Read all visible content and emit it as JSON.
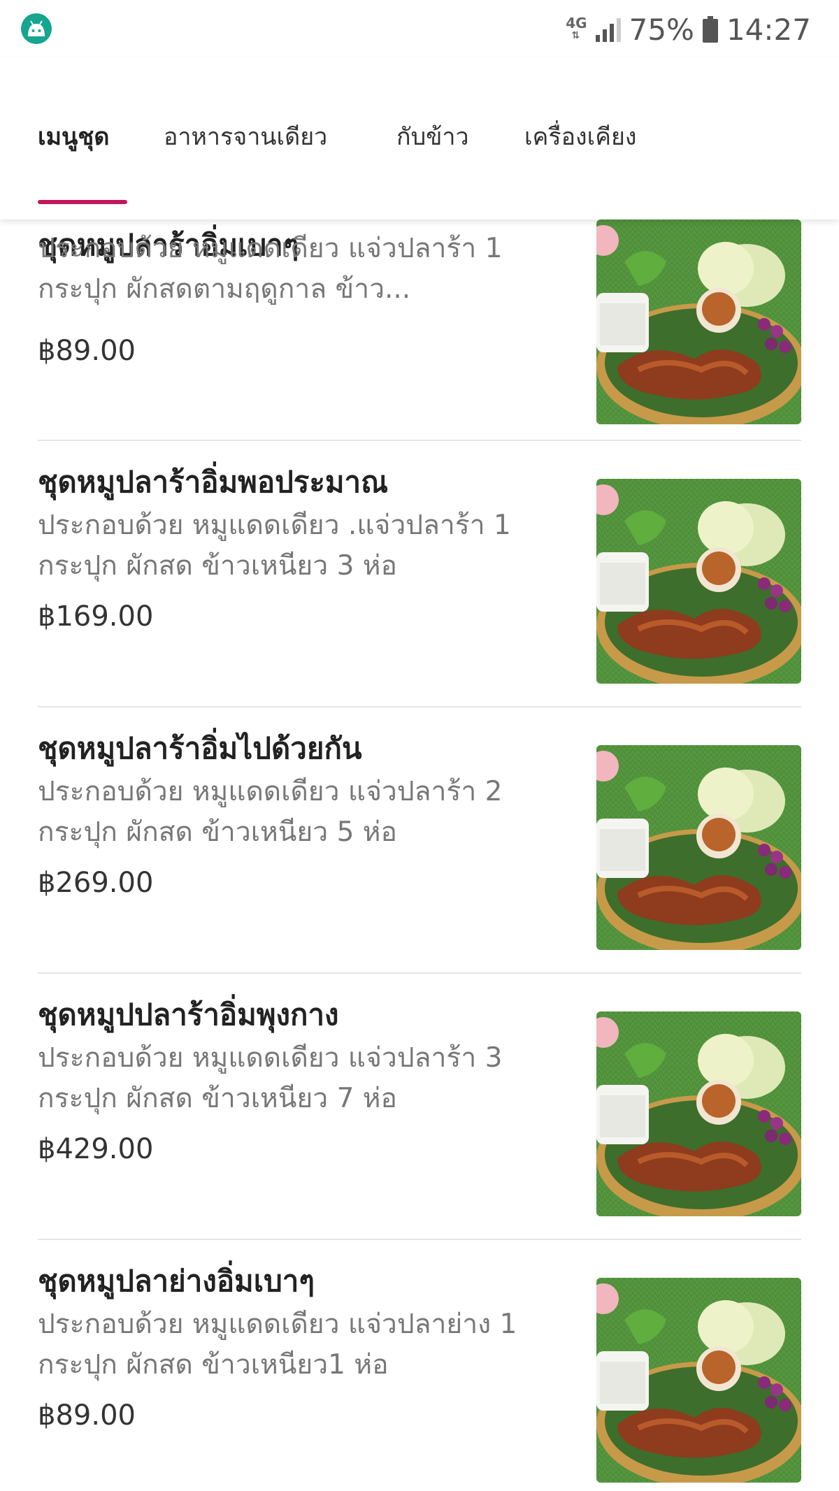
{
  "status_bar": {
    "network": "4G",
    "battery": "75%",
    "time": "14:27",
    "icons": [
      "android-app-icon",
      "network-4g-icon",
      "signal-icon",
      "battery-icon"
    ]
  },
  "tabs": [
    {
      "label": "เมนูชุด",
      "active": true
    },
    {
      "label": "อาหารจานเดียว",
      "active": false
    },
    {
      "label": "กับข้าว",
      "active": false
    },
    {
      "label": "เครื่องเคียง",
      "active": false
    }
  ],
  "accent_color": "#c2185b",
  "items": [
    {
      "title": "ชุดหมูปลาร้าอิ่มเบาๆ",
      "desc": "ประกอบด้วย หมูแดดเดียว แจ่วปลาร้า 1 กระปุก ผักสดตามฤดูกาล ข้าว...",
      "price": "฿89.00",
      "image": "food-photo"
    },
    {
      "title": "ชุดหมูปลาร้าอิ่มพอประมาณ",
      "desc": "ประกอบด้วย หมูแดดเดียว .แจ่วปลาร้า 1 กระปุก ผักสด ข้าวเหนียว 3 ห่อ",
      "price": "฿169.00",
      "image": "food-photo"
    },
    {
      "title": "ชุดหมูปลาร้าอิ่มไปด้วยกัน",
      "desc": "ประกอบด้วย หมูแดดเดียว แจ่วปลาร้า 2 กระปุก ผักสด ข้าวเหนียว 5 ห่อ",
      "price": "฿269.00",
      "image": "food-photo"
    },
    {
      "title": "ชุดหมูปปลาร้าอิ่มพุงกาง",
      "desc": "ประกอบด้วย หมูแดดเดียว แจ่วปลาร้า 3 กระปุก ผักสด ข้าวเหนียว 7 ห่อ",
      "price": "฿429.00",
      "image": "food-photo"
    },
    {
      "title": "ชุดหมูปลาย่างอิ่มเบาๆ",
      "desc": "ประกอบด้วย หมูแดดเดียว แจ่วปลาย่าง 1 กระปุก ผักสด ข้าวเหนียว1 ห่อ",
      "price": "฿89.00",
      "image": "food-photo"
    }
  ]
}
